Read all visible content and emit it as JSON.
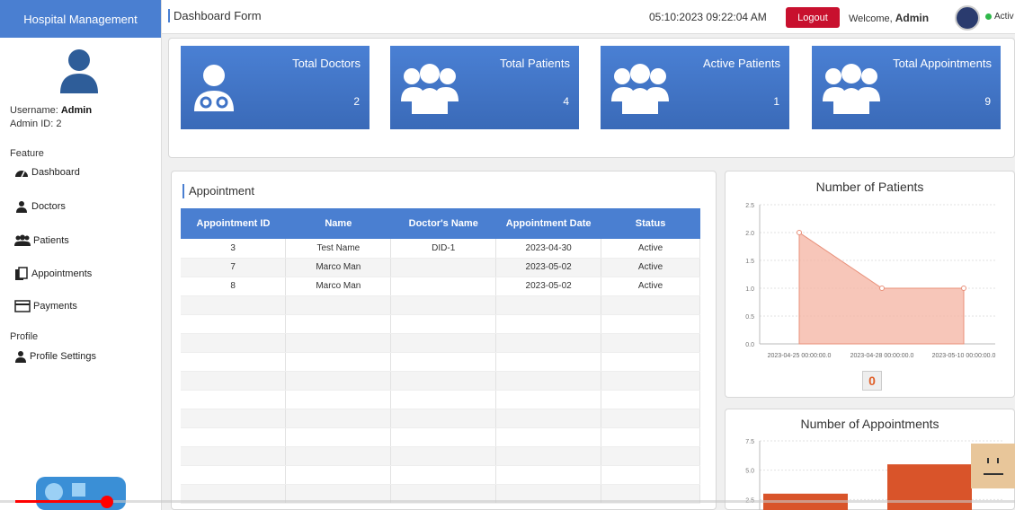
{
  "app": {
    "brand": "Hospital Management"
  },
  "topbar": {
    "title": "Dashboard Form",
    "datetime": "05:10:2023 09:22:04 AM",
    "logout_label": "Logout",
    "welcome_prefix": "Welcome, ",
    "welcome_user": "Admin",
    "status": "Activ"
  },
  "sidebar": {
    "username_label": "Username: ",
    "username": "Admin",
    "admin_id": "Admin ID: 2",
    "feature_heading": "Feature",
    "items": [
      {
        "label": "Dashboard",
        "icon": "dashboard-icon"
      },
      {
        "label": "Doctors",
        "icon": "doctor-icon"
      },
      {
        "label": "Patients",
        "icon": "patients-icon"
      },
      {
        "label": "Appointments",
        "icon": "appointments-icon"
      },
      {
        "label": "Payments",
        "icon": "payment-card-icon"
      }
    ],
    "profile_heading": "Profile",
    "profile_item": "Profile Settings"
  },
  "cards": [
    {
      "title": "Total Doctors",
      "value": "2",
      "icon": "doctor-stethoscope-icon"
    },
    {
      "title": "Total Patients",
      "value": "4",
      "icon": "users-group-icon"
    },
    {
      "title": "Active Patients",
      "value": "1",
      "icon": "users-group-icon"
    },
    {
      "title": "Total Appointments",
      "value": "9",
      "icon": "users-group-icon"
    }
  ],
  "appointment": {
    "title": "Appointment",
    "columns": [
      "Appointment ID",
      "Name",
      "Doctor's Name",
      "Appointment Date",
      "Status"
    ],
    "rows": [
      [
        "3",
        "Test Name",
        "DID-1",
        "2023-04-30",
        "Active"
      ],
      [
        "7",
        "Marco Man",
        "",
        "2023-05-02",
        "Active"
      ],
      [
        "8",
        "Marco Man",
        "",
        "2023-05-02",
        "Active"
      ]
    ]
  },
  "patients_chart": {
    "title": "Number of Patients",
    "badge": "0",
    "chart_data": {
      "type": "area",
      "x": [
        "2023-04-25 00:00:00.0",
        "2023-04-28 00:00:00.0",
        "2023-05-10 00:00:00.0"
      ],
      "values": [
        2,
        1,
        1
      ],
      "ylim": [
        0,
        2.5
      ],
      "yticks": [
        "2.5",
        "2.0",
        "1.5",
        "1.0",
        "0.5",
        "0.0"
      ],
      "color": "#f5b8a8"
    }
  },
  "appointments_chart": {
    "title": "Number of Appointments",
    "chart_data": {
      "type": "bar",
      "yticks": [
        "7.5",
        "5.0",
        "2.5"
      ],
      "values": [
        3,
        5.5
      ],
      "ylim": [
        0,
        7.5
      ],
      "color": "#d9542a"
    }
  }
}
